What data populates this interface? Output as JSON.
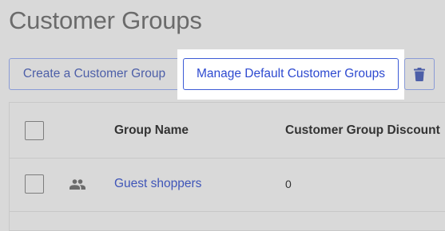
{
  "page": {
    "title": "Customer Groups"
  },
  "toolbar": {
    "create_label": "Create a Customer Group",
    "manage_label": "Manage Default Customer Groups",
    "delete_icon": "trash-icon"
  },
  "table": {
    "columns": [
      "",
      "",
      "Group Name",
      "Customer Group Discount"
    ],
    "rows": [
      {
        "icon": "people-icon",
        "name": "Guest shoppers",
        "discount": "0"
      }
    ]
  },
  "colors": {
    "accent": "#2e4ad0",
    "link": "#3f55b8",
    "background": "#d9d9d9",
    "highlight": "#ffffff"
  }
}
